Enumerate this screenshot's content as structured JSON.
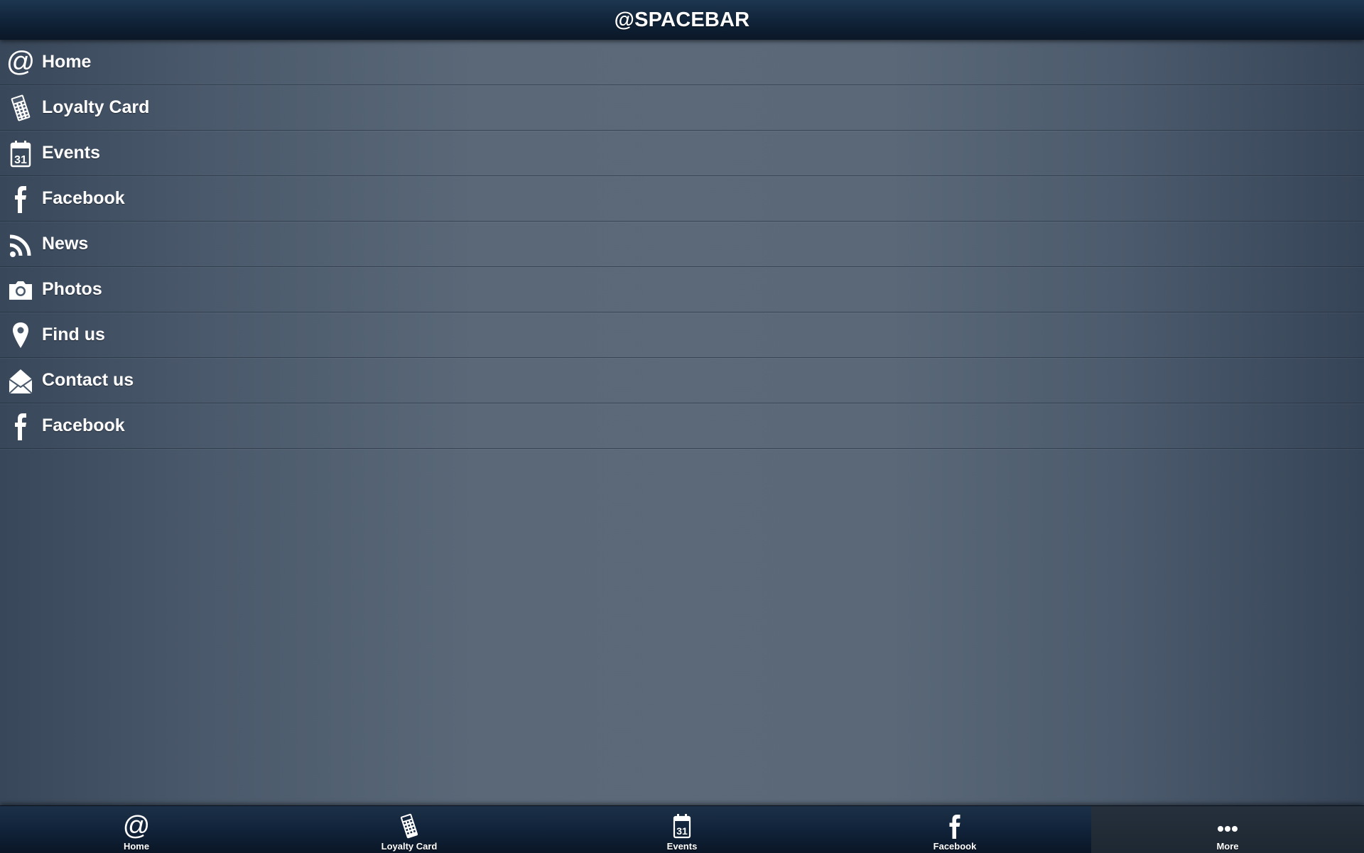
{
  "header": {
    "title": "@SPACEBAR"
  },
  "menu": {
    "items": [
      {
        "label": "Home",
        "icon": "at-icon"
      },
      {
        "label": "Loyalty Card",
        "icon": "calculator-icon"
      },
      {
        "label": "Events",
        "icon": "calendar-icon",
        "icon_text": "31"
      },
      {
        "label": "Facebook",
        "icon": "facebook-icon"
      },
      {
        "label": "News",
        "icon": "rss-icon"
      },
      {
        "label": "Photos",
        "icon": "camera-icon"
      },
      {
        "label": "Find us",
        "icon": "map-pin-icon"
      },
      {
        "label": "Contact us",
        "icon": "envelope-icon"
      },
      {
        "label": "Facebook",
        "icon": "facebook-icon"
      }
    ]
  },
  "tabbar": {
    "tabs": [
      {
        "label": "Home",
        "icon": "at-icon"
      },
      {
        "label": "Loyalty Card",
        "icon": "calculator-icon"
      },
      {
        "label": "Events",
        "icon": "calendar-icon",
        "icon_text": "31"
      },
      {
        "label": "Facebook",
        "icon": "facebook-icon"
      },
      {
        "label": "More",
        "icon": "more-dots-icon",
        "active": true
      }
    ]
  },
  "colors": {
    "header_bar": "#102338",
    "tab_bar": "#11233a",
    "text": "#ffffff",
    "background_center": "#5b6979",
    "background_edge": "#38475a"
  }
}
